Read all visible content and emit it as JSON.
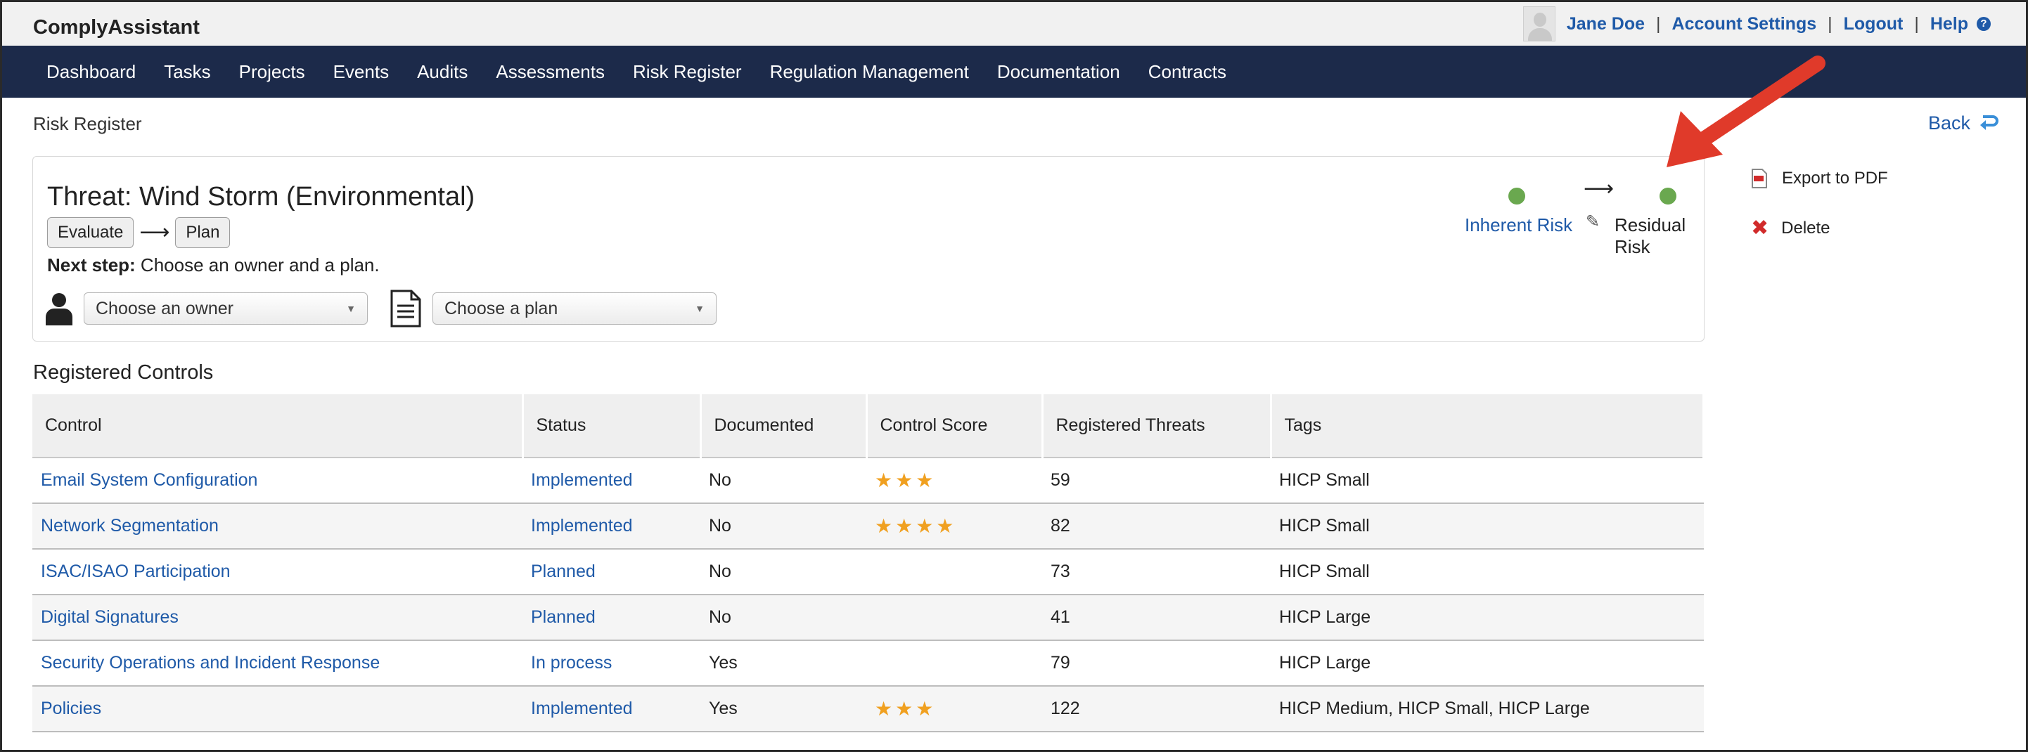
{
  "app": {
    "brand": "ComplyAssistant"
  },
  "user": {
    "name": "Jane Doe",
    "account_settings": "Account Settings",
    "logout": "Logout",
    "help": "Help",
    "separator": "|"
  },
  "nav": {
    "items": [
      {
        "label": "Dashboard"
      },
      {
        "label": "Tasks"
      },
      {
        "label": "Projects"
      },
      {
        "label": "Events"
      },
      {
        "label": "Audits"
      },
      {
        "label": "Assessments"
      },
      {
        "label": "Risk Register"
      },
      {
        "label": "Regulation Management"
      },
      {
        "label": "Documentation"
      },
      {
        "label": "Contracts"
      }
    ]
  },
  "page": {
    "breadcrumb": "Risk Register",
    "back_label": "Back"
  },
  "threat": {
    "title": "Threat: Wind Storm (Environmental)",
    "step_evaluate": "Evaluate",
    "step_plan": "Plan",
    "step_arrow": "⟶",
    "next_step_label": "Next step:",
    "next_step_text": " Choose an owner and a plan.",
    "owner_select": "Choose an owner",
    "plan_select": "Choose a plan",
    "inherent_risk": "Inherent Risk",
    "residual_risk": "Residual Risk",
    "risk_arrow": "⟶",
    "risk_color": "#6aa84f"
  },
  "side_actions": {
    "export_pdf": "Export to PDF",
    "delete": "Delete"
  },
  "controls": {
    "section_title": "Registered Controls",
    "columns": [
      "Control",
      "Status",
      "Documented",
      "Control Score",
      "Registered Threats",
      "Tags"
    ],
    "rows": [
      {
        "control": "Email System Configuration",
        "status": "Implemented",
        "documented": "No",
        "stars": "★★★",
        "threats": "59",
        "tags": "HICP Small"
      },
      {
        "control": "Network Segmentation",
        "status": "Implemented",
        "documented": "No",
        "stars": "★★★★",
        "threats": "82",
        "tags": "HICP Small"
      },
      {
        "control": "ISAC/ISAO Participation",
        "status": "Planned",
        "documented": "No",
        "stars": "",
        "threats": "73",
        "tags": "HICP Small"
      },
      {
        "control": "Digital Signatures",
        "status": "Planned",
        "documented": "No",
        "stars": "",
        "threats": "41",
        "tags": "HICP Large"
      },
      {
        "control": "Security Operations and Incident Response",
        "status": "In process",
        "documented": "Yes",
        "stars": "",
        "threats": "79",
        "tags": "HICP Large"
      },
      {
        "control": "Policies",
        "status": "Implemented",
        "documented": "Yes",
        "stars": "★★★",
        "threats": "122",
        "tags": "HICP Medium, HICP Small, HICP Large"
      }
    ]
  },
  "colors": {
    "nav_bg": "#1c2a4a",
    "link": "#1f5aa8",
    "star": "#f0a020",
    "annotation_arrow": "#e03a2a"
  }
}
